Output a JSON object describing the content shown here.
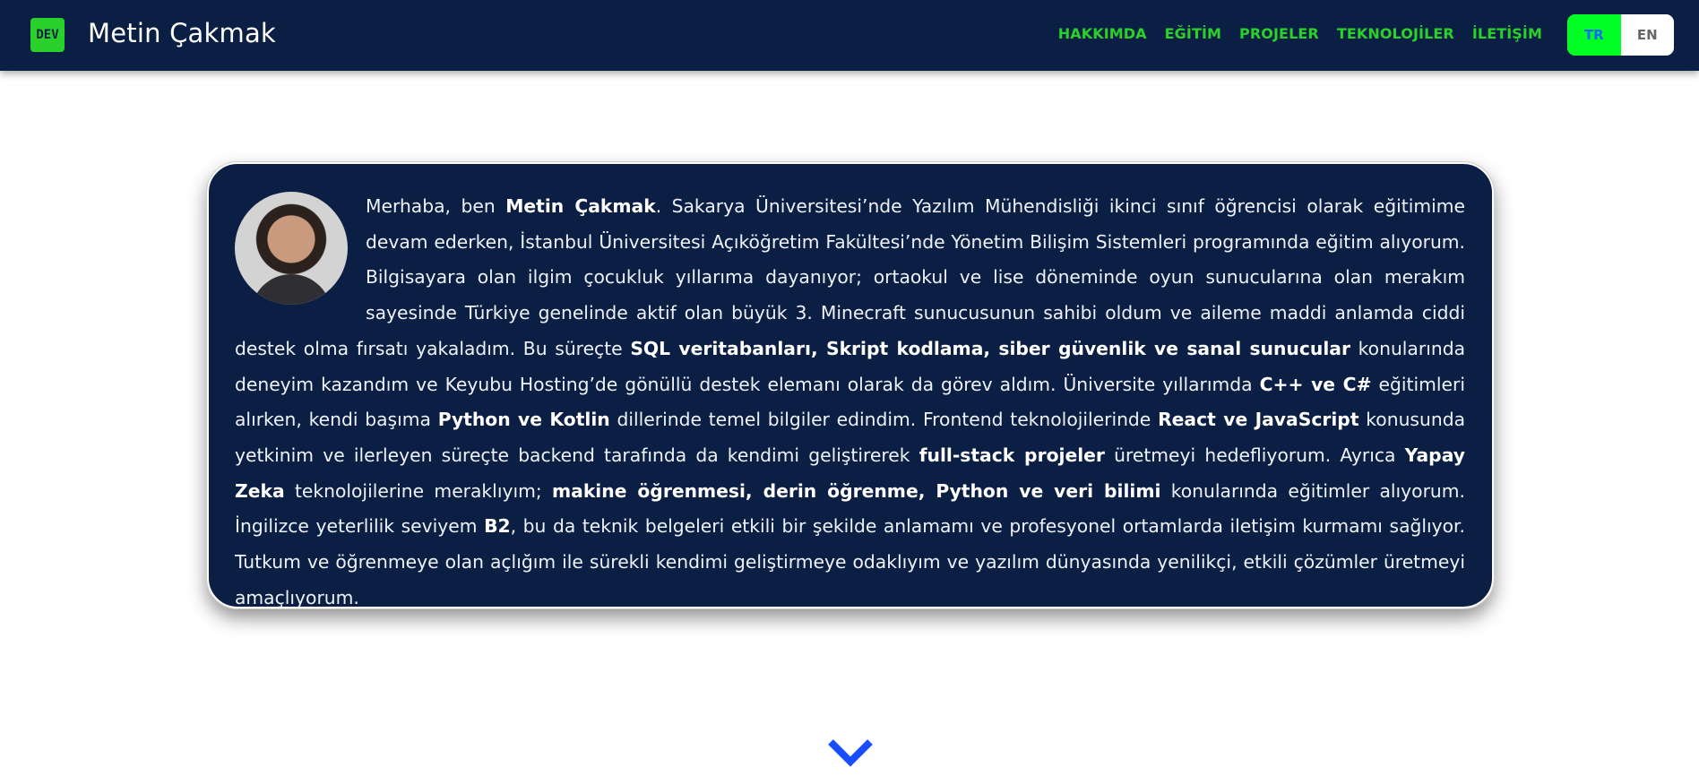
{
  "nav": {
    "logo_text": "DEV",
    "brand": "Metin Çakmak",
    "links": [
      "HAKKIMDA",
      "EĞİTİM",
      "PROJELER",
      "TEKNOLOJİLER",
      "İLETİŞİM"
    ],
    "lang": {
      "active": "TR",
      "inactive": "EN"
    }
  },
  "about": {
    "segments": [
      {
        "t": "Merhaba, ben ",
        "b": false
      },
      {
        "t": "Metin Çakmak",
        "b": true
      },
      {
        "t": ". Sakarya Üniversitesi’nde Yazılım Mühendisliği ikinci sınıf öğrencisi olarak eğitimime devam ederken, İstanbul Üniversitesi Açıköğretim Fakültesi’nde Yönetim Bilişim Sistemleri programında eğitim alıyorum. Bilgisayara olan ilgim çocukluk yıllarıma dayanıyor; ortaokul ve lise döneminde oyun sunucularına olan merakım sayesinde Türkiye genelinde aktif olan büyük 3. Minecraft sunucusunun sahibi oldum ve aileme maddi anlamda ciddi destek olma fırsatı yakaladım. Bu süreçte ",
        "b": false
      },
      {
        "t": "SQL veritabanları, Skript kodlama, siber güvenlik ve sanal sunucular",
        "b": true
      },
      {
        "t": " konularında deneyim kazandım ve Keyubu Hosting’de gönüllü destek elemanı olarak da görev aldım. Üniversite yıllarımda ",
        "b": false
      },
      {
        "t": "C++ ve C#",
        "b": true
      },
      {
        "t": " eğitimleri alırken, kendi başıma ",
        "b": false
      },
      {
        "t": "Python ve Kotlin",
        "b": true
      },
      {
        "t": " dillerinde temel bilgiler edindim. Frontend teknolojilerinde ",
        "b": false
      },
      {
        "t": "React ve JavaScript",
        "b": true
      },
      {
        "t": " konusunda yetkinim ve ilerleyen süreçte backend tarafında da kendimi geliştirerek ",
        "b": false
      },
      {
        "t": "full-stack projeler",
        "b": true
      },
      {
        "t": " üretmeyi hedefliyorum. Ayrıca ",
        "b": false
      },
      {
        "t": "Yapay Zeka",
        "b": true
      },
      {
        "t": " teknolojilerine meraklıyım; ",
        "b": false
      },
      {
        "t": "makine öğrenmesi, derin öğrenme, Python ve veri bilimi",
        "b": true
      },
      {
        "t": " konularında eğitimler alıyorum. İngilizce yeterlilik seviyem ",
        "b": false
      },
      {
        "t": "B2",
        "b": true
      },
      {
        "t": ", bu da teknik belgeleri etkili bir şekilde anlamamı ve profesyonel ortamlarda iletişim kurmamı sağlıyor. Tutkum ve öğrenmeye olan açlığım ile sürekli kendimi geliştirmeye odaklıyım ve yazılım dünyasında yenilikçi, etkili çözümler üretmeyi amaçlıyorum.",
        "b": false
      }
    ]
  },
  "colors": {
    "navy": "#0b1f45",
    "accent_green": "#2bd12b",
    "lang_active_bg": "#00ff22",
    "lang_active_text": "#1565ff",
    "chevron": "#1a4dff"
  },
  "icons": {
    "scroll": "chevron-down-icon"
  }
}
